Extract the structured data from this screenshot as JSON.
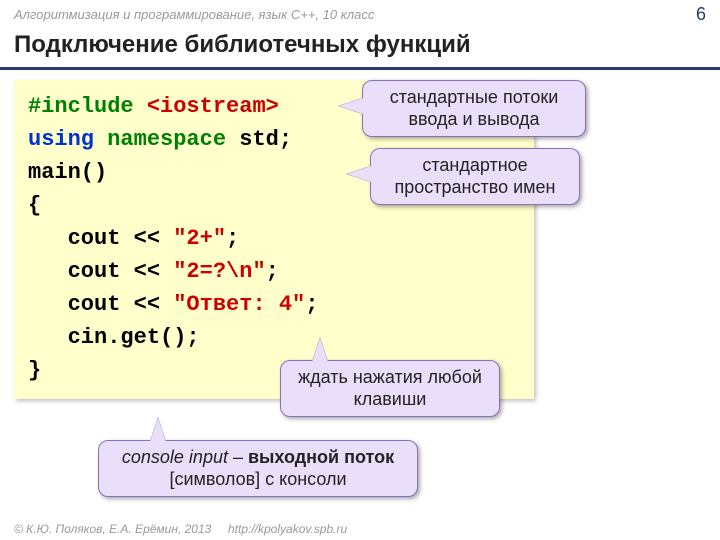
{
  "header": {
    "course": "Алгоритмизация и программирование, язык  C++, 10 класс",
    "page": "6"
  },
  "title": "Подключение библиотечных функций",
  "code": {
    "l1a": "#include ",
    "l1b": "<iostream>",
    "l2a": "using",
    "l2b": " namespace ",
    "l2c": "std;",
    "l3": "main()",
    "l4": "{",
    "l5a": "   cout << ",
    "l5b": "\"2+\"",
    "l5c": ";",
    "l6a": "   cout << ",
    "l6b": "\"2=?\\n\"",
    "l6c": ";",
    "l7a": "   cout << ",
    "l7b": "\"Ответ: 4\"",
    "l7c": ";",
    "l8": "   cin.get();",
    "l9": "}"
  },
  "callouts": {
    "streams": "стандартные потоки ввода и вывода",
    "namespace": "стандартное пространство имен",
    "waitkey": "ждать нажатия любой клавиши",
    "console_it": "console input",
    "console_sep": " – ",
    "console_b": "выходной поток",
    "console_tail": " [символов] с консоли"
  },
  "footer": {
    "copy": "© К.Ю. Поляков, Е.А. Ерёмин, 2013",
    "url": "http://kpolyakov.spb.ru"
  }
}
